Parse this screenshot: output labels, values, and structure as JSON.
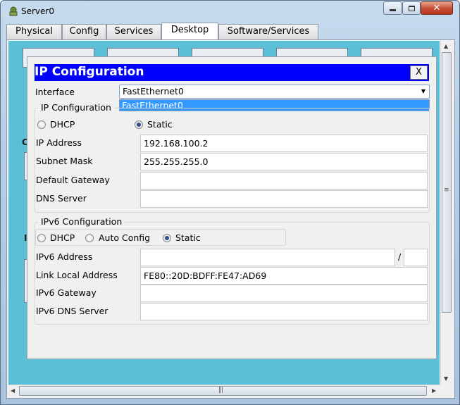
{
  "window": {
    "title": "Server0",
    "minimize_label": "minimize",
    "maximize_label": "maximize",
    "close_label": "close"
  },
  "tabs": [
    {
      "label": "Physical",
      "active": false
    },
    {
      "label": "Config",
      "active": false
    },
    {
      "label": "Services",
      "active": false
    },
    {
      "label": "Desktop",
      "active": true
    },
    {
      "label": "Software/Services",
      "active": false
    }
  ],
  "desktop": {
    "side_letters": [
      "C",
      "I"
    ]
  },
  "dialog": {
    "title": "IP Configuration",
    "close_label": "X",
    "interface_label": "Interface",
    "interface_value": "FastEthernet0",
    "dropdown_options": [
      "FastEthernet0"
    ],
    "ipv4": {
      "group_title": "IP Configuration",
      "dhcp_label": "DHCP",
      "static_label": "Static",
      "selected": "Static",
      "ip_address_label": "IP Address",
      "ip_address_value": "192.168.100.2",
      "subnet_mask_label": "Subnet Mask",
      "subnet_mask_value": "255.255.255.0",
      "default_gateway_label": "Default Gateway",
      "default_gateway_value": "",
      "dns_server_label": "DNS Server",
      "dns_server_value": ""
    },
    "ipv6": {
      "group_title": "IPv6 Configuration",
      "dhcp_label": "DHCP",
      "auto_config_label": "Auto Config",
      "static_label": "Static",
      "selected": "Static",
      "address_label": "IPv6 Address",
      "address_value": "",
      "prefix_separator": "/",
      "prefix_value": "",
      "link_local_label": "Link Local Address",
      "link_local_value": "FE80::20D:BDFF:FE47:AD69",
      "gateway_label": "IPv6 Gateway",
      "gateway_value": "",
      "dns_label": "IPv6 DNS Server",
      "dns_value": ""
    }
  },
  "colors": {
    "desktop_bg": "#5bbfd6",
    "dialog_title_bg": "#0000ff",
    "dropdown_highlight": "#3399ff"
  }
}
